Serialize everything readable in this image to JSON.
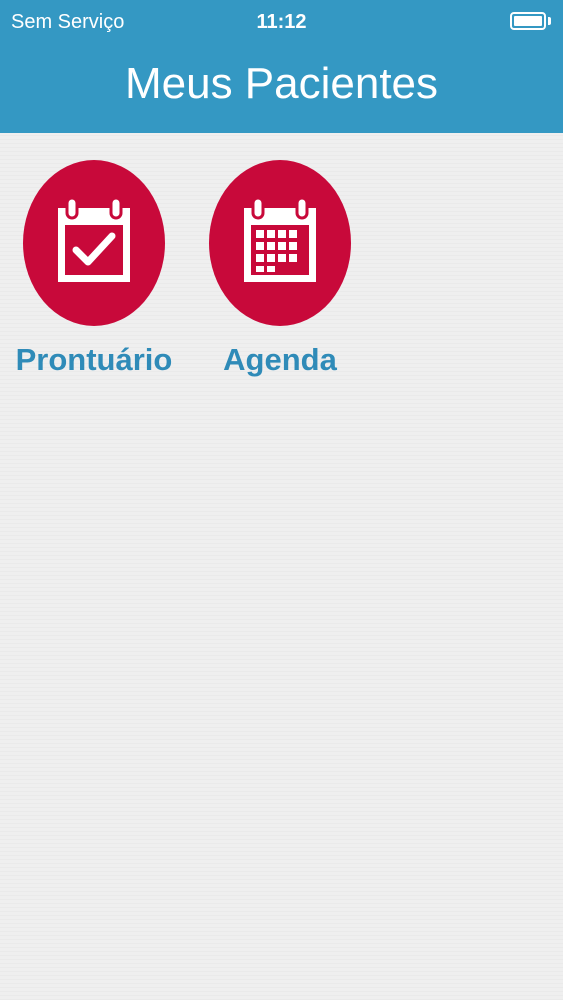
{
  "status_bar": {
    "carrier": "Sem Serviço",
    "time": "11:12",
    "battery_level": 1.0
  },
  "header": {
    "title": "Meus Pacientes"
  },
  "tiles": [
    {
      "label": "Prontuário",
      "icon": "calendar-check-icon"
    },
    {
      "label": "Agenda",
      "icon": "calendar-grid-icon"
    }
  ],
  "colors": {
    "header": "#3498c3",
    "tile_circle": "#c8093a",
    "tile_label": "#2f8bb8",
    "background": "#efefef"
  }
}
